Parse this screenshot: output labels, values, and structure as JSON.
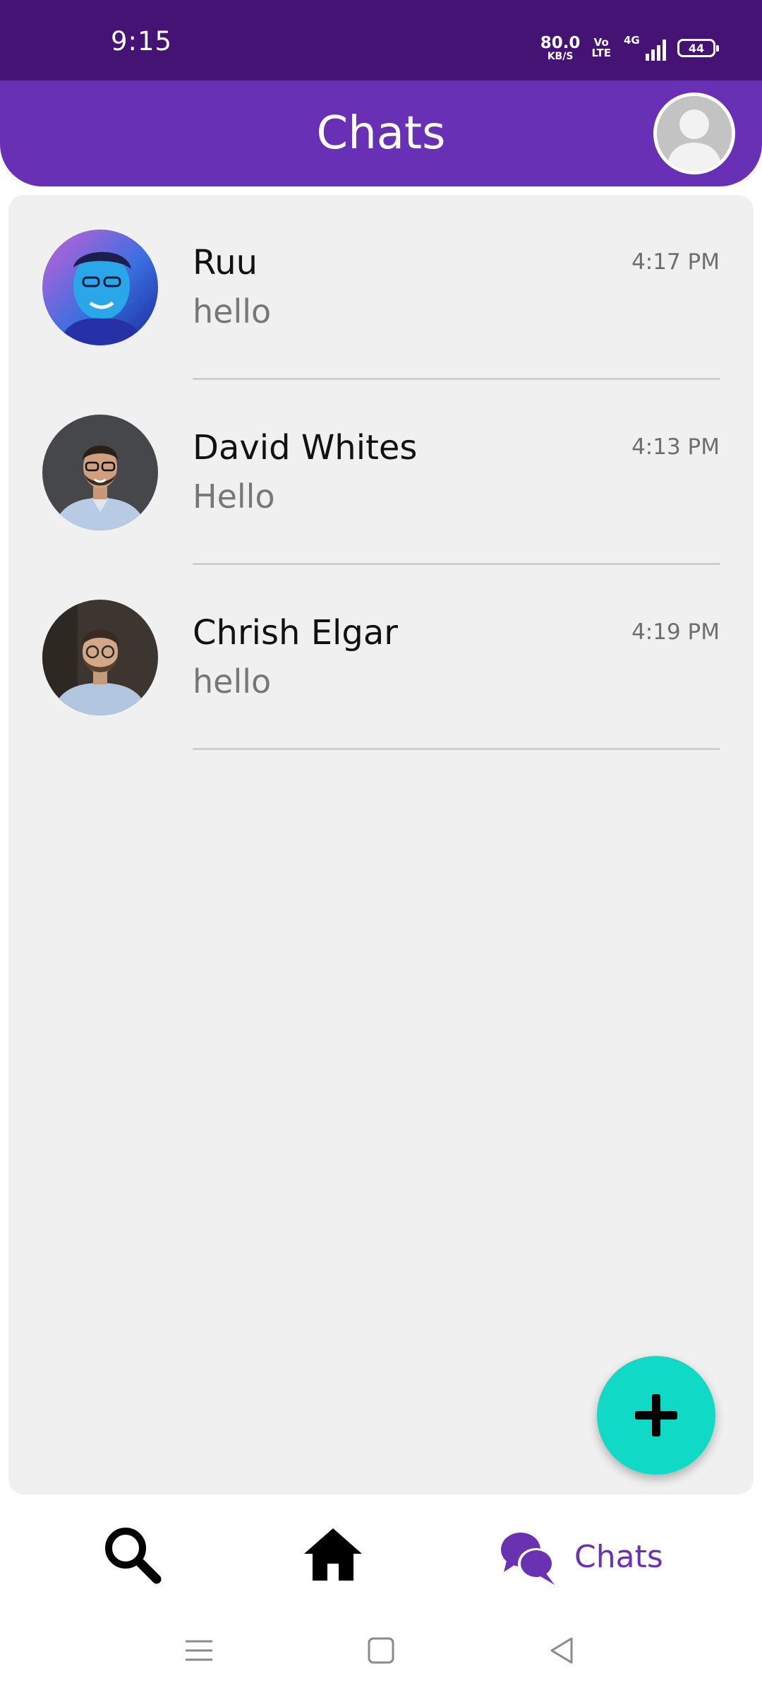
{
  "status_bar": {
    "time": "9:15",
    "net_speed_value": "80.0",
    "net_speed_unit": "KB/S",
    "volte_top": "Vo",
    "volte_bottom": "LTE",
    "network_type": "4G",
    "battery_level": "44"
  },
  "header": {
    "title": "Chats"
  },
  "chats": [
    {
      "name": "Ruu",
      "message": "hello",
      "time": "4:17 PM"
    },
    {
      "name": "David Whites",
      "message": "Hello",
      "time": "4:13 PM"
    },
    {
      "name": "Chrish Elgar",
      "message": "hello",
      "time": "4:19 PM"
    }
  ],
  "bottom_nav": {
    "chats_label": "Chats"
  },
  "icons": {
    "search": "search-icon",
    "home": "home-icon",
    "chats": "chat-bubbles-icon",
    "add": "plus-icon",
    "menu": "menu-icon",
    "home_sys": "square-icon",
    "back": "back-triangle-icon"
  },
  "colors": {
    "status_bar": "#451373",
    "header": "#6830b4",
    "accent": "#6a32b0",
    "fab": "#10d9c5",
    "card_background": "#f0f0f0"
  }
}
